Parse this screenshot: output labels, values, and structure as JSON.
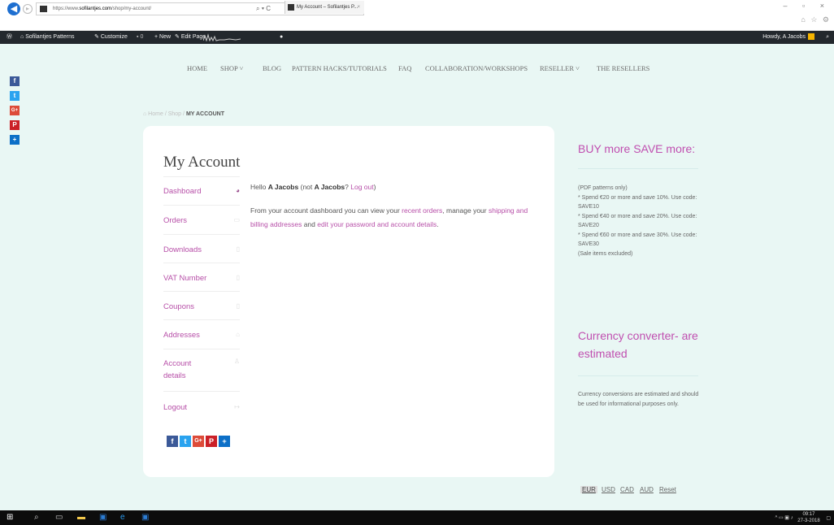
{
  "browser": {
    "url_prefix": "https://www.",
    "url_host": "sofilantjes.com",
    "url_path": "/shop/my-account/",
    "url_tools": "⌕ ▾ C",
    "tab_title": "My Account – Sofilantjes P...",
    "tab_close": "×",
    "window_controls": "– ▫ ×",
    "chrome_icons": "⌂ ☆ ⚙"
  },
  "adminbar": {
    "site": "Sofilantjes Patterns",
    "customize": "Customize",
    "comments": "0",
    "new": "New",
    "edit_page": "Edit Page",
    "greeting": "Howdy, A Jacobs"
  },
  "nav": {
    "items": [
      "HOME",
      "SHOP ˅",
      "BLOG",
      "PATTERN HACKS/TUTORIALS",
      "FAQ",
      "COLLABORATION/WORKSHOPS",
      "RESELLER ˅",
      "THE RESELLERS"
    ]
  },
  "social_bar": {
    "icons": [
      "facebook-icon",
      "twitter-icon",
      "google-plus-icon",
      "pinterest-icon",
      "share-plus-icon"
    ],
    "glyphs": [
      "f",
      "t",
      "G+",
      "P",
      "+"
    ]
  },
  "breadcrumb": {
    "home": "⌂ Home",
    "sep": "/",
    "shop": "Shop",
    "current": "MY ACCOUNT"
  },
  "account": {
    "title": "My Account",
    "menu": [
      {
        "label": "Dashboard",
        "icon": "dashboard-icon",
        "glyph": "◕"
      },
      {
        "label": "Orders",
        "icon": "orders-icon",
        "glyph": "▭"
      },
      {
        "label": "Downloads",
        "icon": "downloads-icon",
        "glyph": "▯"
      },
      {
        "label": "VAT Number",
        "icon": "vat-number-icon",
        "glyph": "▯"
      },
      {
        "label": "Coupons",
        "icon": "coupons-icon",
        "glyph": "▯"
      },
      {
        "label": "Addresses",
        "icon": "addresses-icon",
        "glyph": "⌂"
      },
      {
        "label": "Account details",
        "icon": "account-details-icon",
        "glyph": "♙"
      },
      {
        "label": "Logout",
        "icon": "logout-icon",
        "glyph": "↦"
      }
    ],
    "greeting": {
      "hello": "Hello",
      "name": "A Jacobs",
      "not_prefix": "(not",
      "not_name": "A Jacobs",
      "question": "?",
      "logout": "Log out",
      "close": ")"
    },
    "intro": {
      "text1": "From your account dashboard you can view your",
      "recent_orders": "recent orders",
      "text2": ", manage your",
      "addresses": "shipping and billing addresses",
      "text3": "and",
      "password": "edit your password and account details",
      "text4": "."
    }
  },
  "sidebar": {
    "promo_title": "BUY more SAVE more:",
    "promo_lines": [
      "(PDF patterns only)",
      "* Spend €20 or more and save 10%. Use code: SAVE10",
      "* Spend €40 or more and save 20%. Use code: SAVE20",
      "* Spend €60 or more and save 30%. Use code: SAVE30",
      "(Sale items excluded)"
    ],
    "currency_title": "Currency converter- are estimated",
    "currency_note": "Currency conversions are estimated and should be used for informational purposes only.",
    "currencies": [
      "EUR",
      "USD",
      "CAD",
      "AUD"
    ],
    "reset": "Reset",
    "active_currency": "EUR"
  },
  "taskbar": {
    "time": "09:17",
    "date": "27-3-2018",
    "tray_icons": "^ ▭ ▣ ♪"
  },
  "colors": {
    "accent": "#b74fa8",
    "background": "#e9f7f4",
    "facebook": "#3b5998",
    "twitter": "#2aa3ef",
    "google_plus": "#dd4b39",
    "pinterest": "#cb2027",
    "share": "#0c6fc7"
  }
}
